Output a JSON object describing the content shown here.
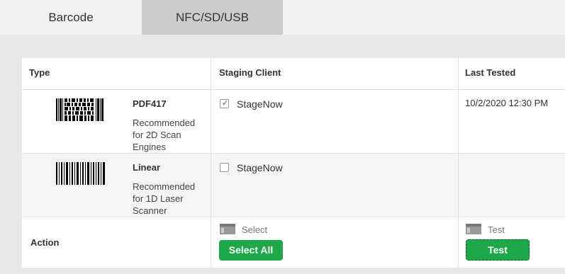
{
  "tabs": [
    {
      "label": "Barcode",
      "active": true
    },
    {
      "label": "NFC/SD/USB",
      "active": false
    }
  ],
  "table": {
    "headers": {
      "type": "Type",
      "client": "Staging Client",
      "tested": "Last Tested"
    },
    "rows": [
      {
        "name": "PDF417",
        "desc_lines": [
          "Recommended",
          "for 2D Scan",
          "Engines"
        ],
        "client": "StageNow",
        "checked": true,
        "last_tested": "10/2/2020 12:30 PM",
        "barcode_icon": "pdf417-barcode-icon"
      },
      {
        "name": "Linear",
        "desc_lines": [
          "Recommended",
          "for 1D Laser",
          "Scanner"
        ],
        "client": "StageNow",
        "checked": false,
        "last_tested": "",
        "barcode_icon": "linear-barcode-icon"
      }
    ],
    "action": {
      "label": "Action",
      "select_label": "Select",
      "select_all_button": "Select All",
      "test_label": "Test",
      "test_button": "Test"
    }
  },
  "colors": {
    "accent_green": "#1fa84a",
    "tab_inactive": "#cccccc",
    "page_bg": "#e8e8e8"
  }
}
